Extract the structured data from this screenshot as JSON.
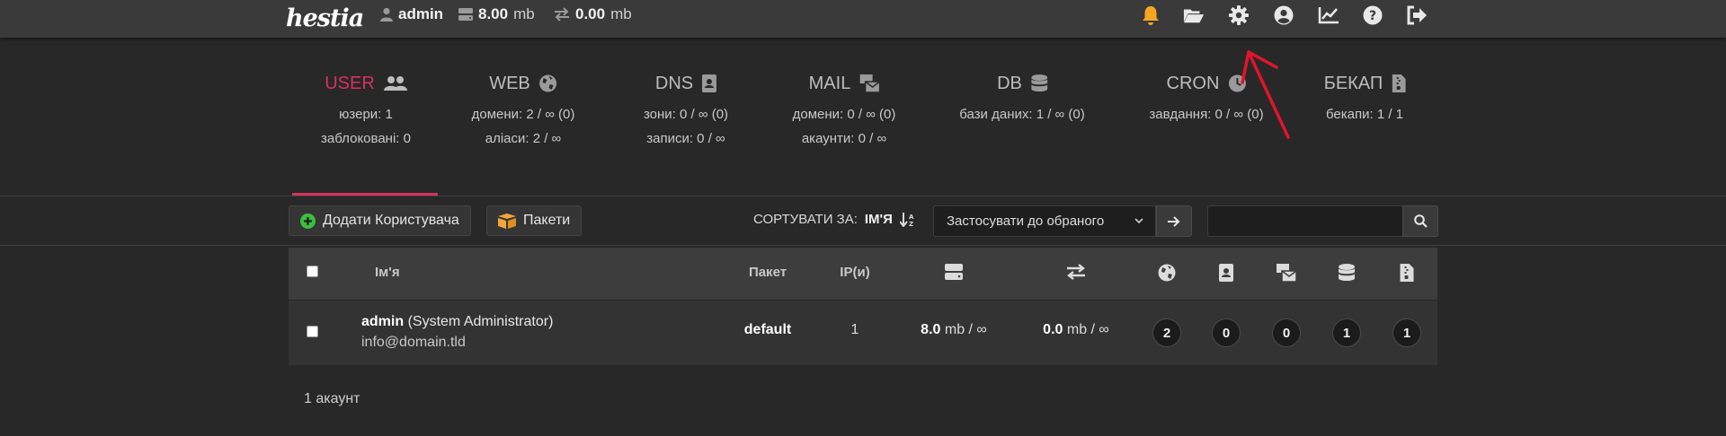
{
  "topbar": {
    "logo": "hestia",
    "user": "admin",
    "disk_value": "8.00",
    "disk_unit": "mb",
    "bandwidth_value": "0.00",
    "bandwidth_unit": "mb",
    "icons": [
      "bell-icon",
      "folder-icon",
      "gear-icon",
      "user-circle-icon",
      "chart-line-icon",
      "help-icon",
      "logout-icon"
    ]
  },
  "tabs": [
    {
      "title": "USER",
      "lines": [
        "юзери: 1",
        "заблоковані: 0"
      ]
    },
    {
      "title": "WEB",
      "lines": [
        "домени: 2 / ∞ (0)",
        "аліаси: 2 / ∞"
      ]
    },
    {
      "title": "DNS",
      "lines": [
        "зони: 0 / ∞ (0)",
        "записи: 0 / ∞"
      ]
    },
    {
      "title": "MAIL",
      "lines": [
        "домени: 0 / ∞ (0)",
        "акаунти: 0 / ∞"
      ]
    },
    {
      "title": "DB",
      "lines": [
        "бази даних: 1 / ∞ (0)"
      ]
    },
    {
      "title": "CRON",
      "lines": [
        "завдання: 0 / ∞ (0)"
      ]
    },
    {
      "title": "БЕКАП",
      "lines": [
        "бекапи: 1 / 1"
      ]
    }
  ],
  "toolbar": {
    "add_user_label": "Додати Користувача",
    "packages_label": "Пакети",
    "sort_label": "СОРТУВАТИ ЗА:",
    "sort_value": "ІМ'Я",
    "bulk_action": "Застосувати до обраного",
    "search_value": ""
  },
  "table": {
    "headers": {
      "name": "Ім'я",
      "package": "Пакет",
      "ips": "IP(и)"
    },
    "rows": [
      {
        "username": "admin",
        "fullname": "(System Administrator)",
        "email": "info@domain.tld",
        "package": "default",
        "ips": "1",
        "disk_value": "8.0",
        "disk_rest": "mb / ∞",
        "bw_value": "0.0",
        "bw_rest": "mb / ∞",
        "web": "2",
        "dns": "0",
        "mail": "0",
        "db": "1",
        "backup": "1"
      }
    ]
  },
  "footer": {
    "count": "1 акаунт"
  },
  "colors": {
    "accent": "#d6315e",
    "annotation_arrow": "#e0152a",
    "add_icon": "#3cbf3c",
    "bell": "#f5a623"
  }
}
